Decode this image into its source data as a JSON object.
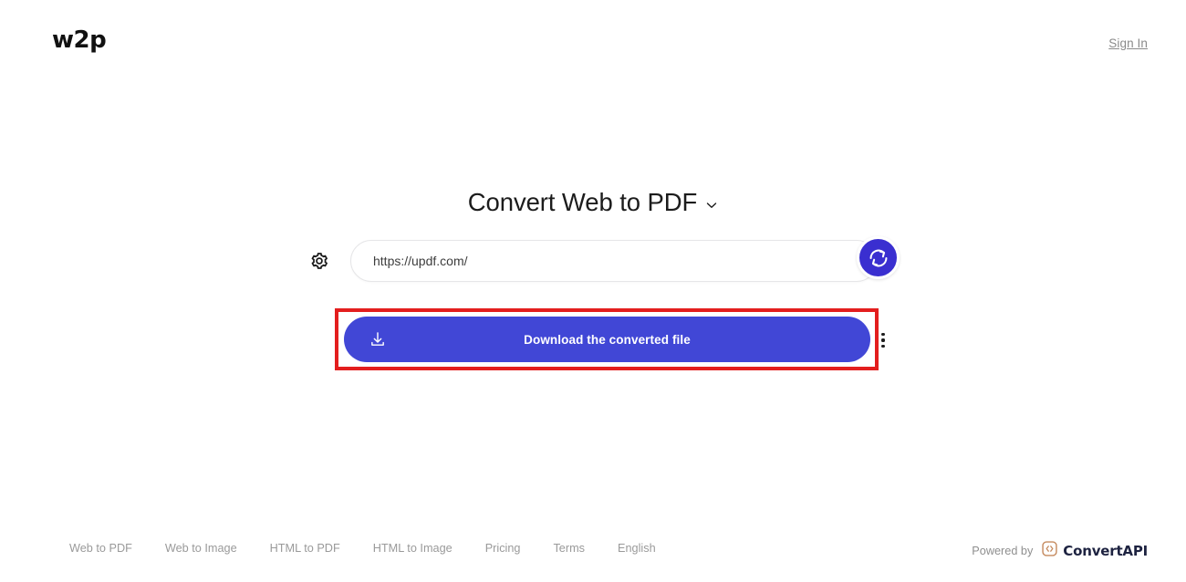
{
  "header": {
    "logo_text": "w2p",
    "sign_in_label": "Sign In"
  },
  "main": {
    "title": "Convert Web to PDF",
    "title_dropdown_icon": "chevron-down-icon",
    "settings_icon": "gear-icon",
    "url_field": {
      "value": "https://updf.com/",
      "placeholder": "https://"
    },
    "convert_button": {
      "icon": "refresh-circle-icon",
      "color": "#3a2fd0"
    },
    "download_button": {
      "label": "Download the converted file",
      "icon": "download-icon",
      "color": "#4147d6"
    },
    "overflow_menu": {
      "icon": "kebab-menu-icon"
    },
    "highlight": {
      "color": "#e31e1e"
    }
  },
  "footer": {
    "links": [
      {
        "label": "Web to PDF"
      },
      {
        "label": "Web to Image"
      },
      {
        "label": "HTML to PDF"
      },
      {
        "label": "HTML to Image"
      },
      {
        "label": "Pricing"
      },
      {
        "label": "Terms"
      },
      {
        "label": "English"
      }
    ],
    "powered_by_text": "Powered by",
    "brand_name": "ConvertAPI",
    "brand_icon": "convertapi-logo-icon",
    "brand_color": "#c58a5e"
  }
}
